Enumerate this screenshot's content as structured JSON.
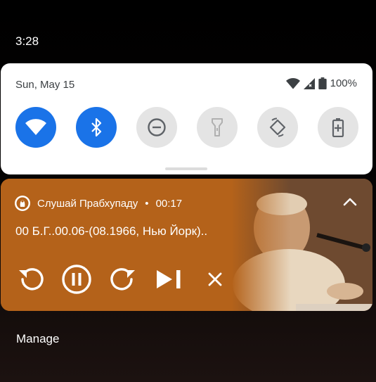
{
  "status_bar": {
    "time": "3:28"
  },
  "quick_settings": {
    "date": "Sun, May 15",
    "battery_percent": "100%",
    "accent_color": "#1a73e8",
    "tiles": [
      {
        "icon": "wifi-icon",
        "active": true
      },
      {
        "icon": "bluetooth-icon",
        "active": true
      },
      {
        "icon": "do-not-disturb-icon",
        "active": false
      },
      {
        "icon": "flashlight-icon",
        "active": false
      },
      {
        "icon": "auto-rotate-icon",
        "active": false
      },
      {
        "icon": "battery-saver-icon",
        "active": false
      }
    ]
  },
  "media": {
    "app_name": "Слушай Прабхупаду",
    "separator": "•",
    "elapsed": "00:17",
    "title": "00 Б.Г..00.06-(08.1966, Нью Йорк)..",
    "card_color": "#b4621a",
    "controls": [
      "replay-icon",
      "pause-icon",
      "forward-icon",
      "skip-next-icon",
      "close-icon"
    ]
  },
  "footer": {
    "manage_label": "Manage"
  }
}
